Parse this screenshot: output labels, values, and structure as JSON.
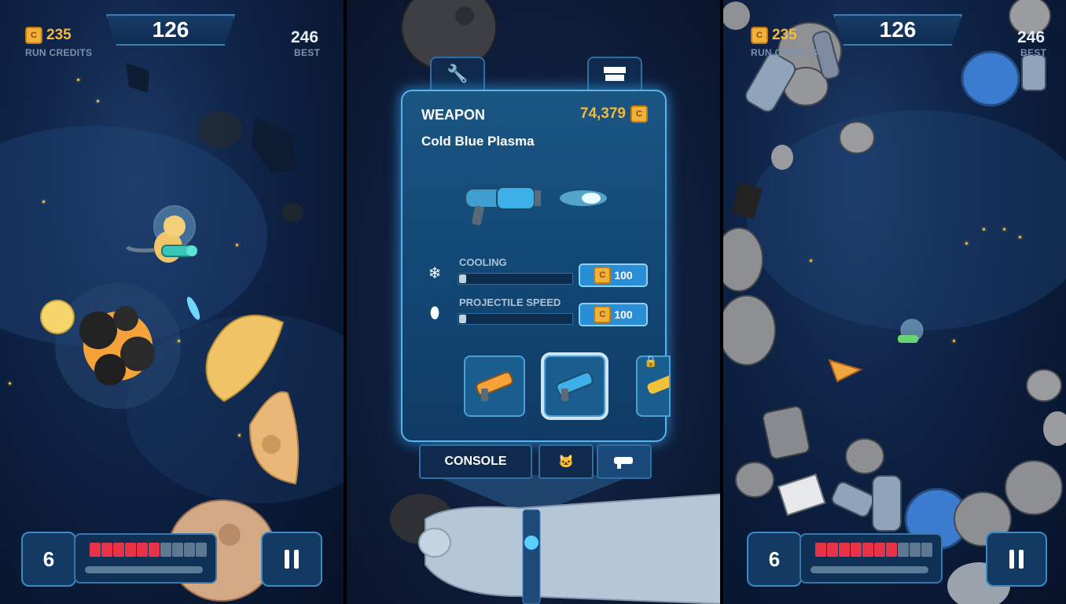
{
  "left_screen": {
    "score": "126",
    "run_credits_value": "235",
    "run_credits_label": "RUN CREDITS",
    "best_value": "246",
    "best_label": "BEST",
    "lives": "6",
    "health_segments_total": 10,
    "health_segments_filled": 6
  },
  "console": {
    "category": "WEAPON",
    "credits": "74,379",
    "weapon_name": "Cold Blue Plasma",
    "upgrades": [
      {
        "label": "COOLING",
        "price": "100",
        "level": 0.06,
        "icon": "snowflake-icon"
      },
      {
        "label": "PROJECTILE SPEED",
        "price": "100",
        "level": 0.06,
        "icon": "bullet-icon"
      }
    ],
    "tabs_top": [
      "wrench-icon",
      "shop-icon"
    ],
    "tabs_bottom": {
      "console_label": "CONSOLE",
      "cat_icon": "cat-icon",
      "gun_icon": "gun-icon"
    },
    "weapon_slots": [
      {
        "name": "orange-blaster",
        "locked": false,
        "selected": false
      },
      {
        "name": "cold-blue-plasma",
        "locked": false,
        "selected": true
      },
      {
        "name": "yellow-blaster",
        "locked": true,
        "selected": false
      }
    ],
    "colors": {
      "accent": "#58b4e8",
      "gold": "#f5b83b",
      "health": "#e8324a"
    }
  },
  "right_screen": {
    "score": "126",
    "run_credits_value": "235",
    "run_credits_label": "RUN CREDITS",
    "best_value": "246",
    "best_label": "BEST",
    "lives": "6",
    "health_segments_total": 10,
    "health_segments_filled": 7
  }
}
